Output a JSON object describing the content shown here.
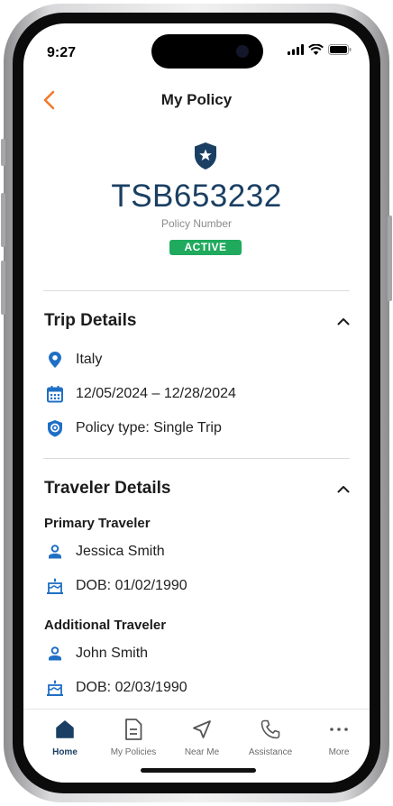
{
  "status_bar": {
    "time": "9:27"
  },
  "header": {
    "title": "My Policy"
  },
  "policy": {
    "number": "TSB653232",
    "number_label": "Policy Number",
    "status": "ACTIVE"
  },
  "trip_details": {
    "title": "Trip Details",
    "items": [
      {
        "icon": "location-pin-icon",
        "text": "Italy"
      },
      {
        "icon": "calendar-icon",
        "text": "12/05/2024 – 12/28/2024"
      },
      {
        "icon": "shield-policy-icon",
        "text": "Policy type: Single Trip"
      }
    ]
  },
  "traveler_details": {
    "title": "Traveler Details",
    "primary": {
      "heading": "Primary Traveler",
      "name": "Jessica Smith",
      "dob": "DOB: 01/02/1990"
    },
    "additional": {
      "heading": "Additional Traveler",
      "name": "John Smith",
      "dob": "DOB: 02/03/1990"
    }
  },
  "tabbar": {
    "tabs": [
      {
        "label": "Home",
        "icon": "home-icon",
        "active": true
      },
      {
        "label": "My Policies",
        "icon": "document-icon",
        "active": false
      },
      {
        "label": "Near Me",
        "icon": "navigation-arrow-icon",
        "active": false
      },
      {
        "label": "Assistance",
        "icon": "phone-icon",
        "active": false
      },
      {
        "label": "More",
        "icon": "more-dots-icon",
        "active": false
      }
    ]
  },
  "colors": {
    "primary": "#1a3f63",
    "accent": "#f07a2b",
    "active_badge": "#1faa5d",
    "icon_blue": "#1f6fc5"
  }
}
